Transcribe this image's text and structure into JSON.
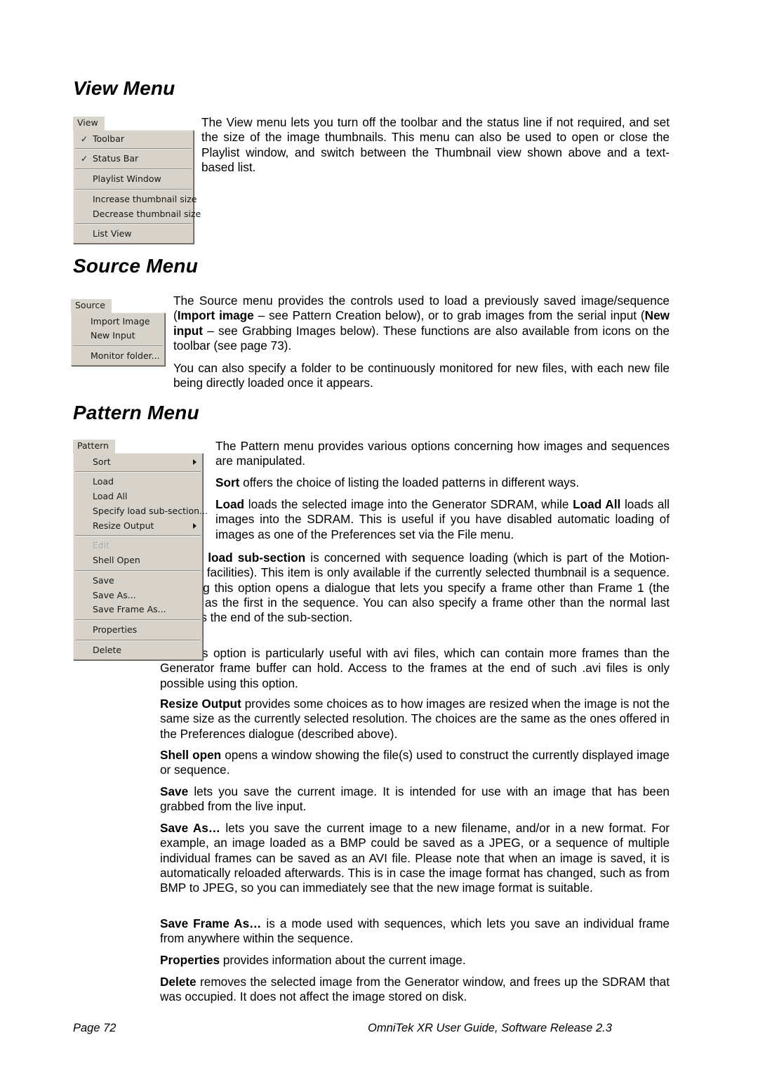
{
  "document": {
    "footer": {
      "page_label": "Page 72",
      "guide_title": "OmniTek XR User Guide, Software Release 2.3"
    }
  },
  "sections": {
    "view": {
      "heading": "View Menu",
      "menu": {
        "tab_label": "View",
        "items": [
          {
            "label": "Toolbar",
            "checked": true
          },
          {
            "label": "Status Bar",
            "checked": true
          },
          {
            "label": "Playlist Window",
            "checked": false
          },
          {
            "label": "Increase thumbnail size",
            "checked": false
          },
          {
            "label": "Decrease thumbnail size",
            "checked": false
          },
          {
            "label": "List View",
            "checked": false
          }
        ]
      },
      "paragraphs": [
        "The View menu lets you turn off the toolbar and the status line if not required, and set the size of the image thumbnails. This menu can also be used to open or close the Playlist window, and switch between the Thumbnail view shown above and a text-based list."
      ]
    },
    "source": {
      "heading": "Source Menu",
      "menu": {
        "tab_label": "Source",
        "items": [
          {
            "label": "Import Image"
          },
          {
            "label": "New Input"
          },
          {
            "label": "Monitor folder..."
          }
        ]
      },
      "paragraph_1": {
        "run_1": "The Source menu provides the controls used to load a previously saved image/sequence (",
        "bold_1": "Import image",
        "run_2": " – see Pattern Creation below), or to grab images from the serial input (",
        "bold_2": "New input",
        "run_3": " – see Grabbing Images below). These functions are also available from icons on the toolbar (see page 73)."
      },
      "paragraph_2": "You can also specify a folder to be continuously monitored for new files, with each new file being directly loaded once it appears."
    },
    "pattern": {
      "heading": "Pattern Menu",
      "menu": {
        "tab_label": "Pattern",
        "items": [
          {
            "label": "Sort",
            "submenu": true,
            "disabled": false
          },
          {
            "label": "Load",
            "submenu": false,
            "disabled": false
          },
          {
            "label": "Load All",
            "submenu": false,
            "disabled": false
          },
          {
            "label": "Specify load sub-section...",
            "submenu": false,
            "disabled": false
          },
          {
            "label": "Resize Output",
            "submenu": true,
            "disabled": false
          },
          {
            "label": "Edit",
            "submenu": false,
            "disabled": true
          },
          {
            "label": "Shell Open",
            "submenu": false,
            "disabled": false
          },
          {
            "label": "Save",
            "submenu": false,
            "disabled": false
          },
          {
            "label": "Save As...",
            "submenu": false,
            "disabled": false
          },
          {
            "label": "Save Frame As...",
            "submenu": false,
            "disabled": false
          },
          {
            "label": "Properties",
            "submenu": false,
            "disabled": false
          },
          {
            "label": "Delete",
            "submenu": false,
            "disabled": false
          }
        ]
      },
      "paragraphs": {
        "intro": "The Pattern menu provides various options concerning how images and sequences are manipulated.",
        "sort": {
          "term": "Sort",
          "rest": " offers the choice of listing the loaded patterns in different ways."
        },
        "load": {
          "term": "Load",
          "rest_1": " loads the selected image into the Generator SDRAM, while ",
          "term_2": "Load All",
          "rest_2": " loads all images into the SDRAM. This is useful if you have disabled automatic loading of images as one of the Preferences set via the File menu."
        },
        "specify": {
          "term": "Specify load sub-section",
          "rest": " is concerned with sequence loading (which is part of the Motion-Capture facilities). This item is only available if the currently selected thumbnail is a sequence. Selecting this option opens a dialogue that lets you specify a frame other than Frame 1 (the default) as the first in the sequence. You can also specify a frame other than the normal last frame as the end of the sub-section."
        },
        "avi": "This option is particularly useful with avi files, which can contain more frames than the Generator frame buffer can hold. Access to the frames at the end of such .avi files is only possible using this option.",
        "resize": {
          "term": "Resize Output",
          "rest": " provides some choices as to how images are resized when the image is not the same size as the currently selected resolution. The choices are the same as the ones offered in the Preferences dialogue (described above)."
        },
        "shell": {
          "term": "Shell open",
          "rest": " opens a window showing the file(s) used to construct the currently displayed image or sequence."
        },
        "save": {
          "term": "Save",
          "rest": " lets you save the current image. It is intended for use with an image that has been grabbed from the live input."
        },
        "saveas": {
          "term": "Save As…",
          "rest": " lets you save the current image to a new filename, and/or in a new format. For example, an image loaded as a BMP could be saved as a JPEG, or a sequence of multiple individual frames can be saved as an AVI file. Please note that when an image is saved, it is automatically reloaded afterwards. This is in case the image format has changed, such as from BMP to JPEG, so you can immediately see that the new image format is suitable."
        },
        "saveframeas": {
          "term": "Save Frame As…",
          "rest": " is a mode used with sequences, which lets you save an individual frame from anywhere within the sequence."
        },
        "properties": {
          "term": "Properties",
          "rest": " provides information about the current image."
        },
        "delete": {
          "term": "Delete",
          "rest": " removes the selected image from the Generator window, and frees up the SDRAM that was occupied. It does not affect the image stored on disk."
        }
      }
    }
  }
}
